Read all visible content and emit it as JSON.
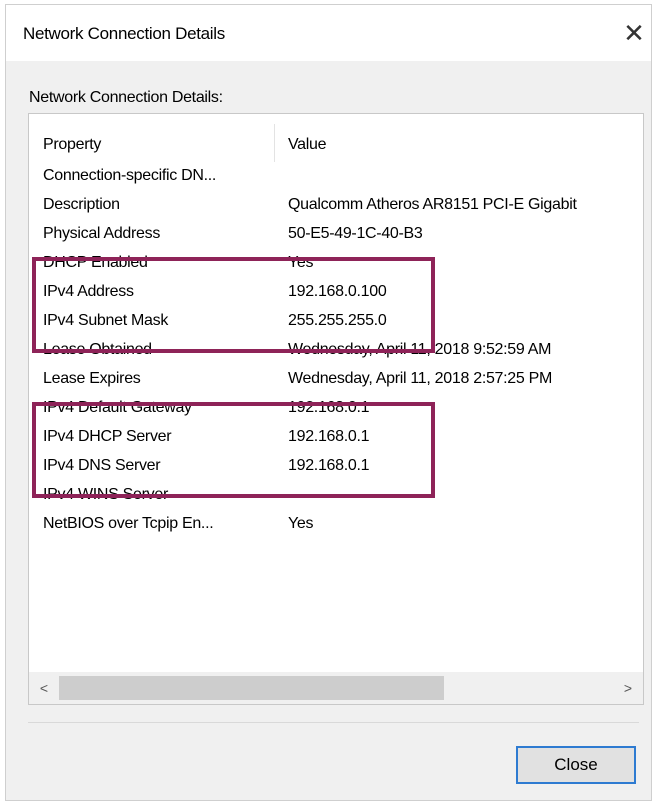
{
  "window": {
    "title": "Network Connection Details",
    "close_glyph": "✕"
  },
  "group_label": "Network Connection Details:",
  "columns": {
    "property": "Property",
    "value": "Value"
  },
  "rows": [
    {
      "property": "Connection-specific DN...",
      "value": ""
    },
    {
      "property": "Description",
      "value": "Qualcomm Atheros AR8151 PCI-E Gigabit"
    },
    {
      "property": "Physical Address",
      "value": "50-E5-49-1C-40-B3"
    },
    {
      "property": "DHCP Enabled",
      "value": "Yes"
    },
    {
      "property": "IPv4 Address",
      "value": "192.168.0.100"
    },
    {
      "property": "IPv4 Subnet Mask",
      "value": "255.255.255.0"
    },
    {
      "property": "Lease Obtained",
      "value": "Wednesday, April 11, 2018 9:52:59 AM"
    },
    {
      "property": "Lease Expires",
      "value": "Wednesday, April 11, 2018 2:57:25 PM"
    },
    {
      "property": "IPv4 Default Gateway",
      "value": "192.168.0.1"
    },
    {
      "property": "IPv4 DHCP Server",
      "value": "192.168.0.1"
    },
    {
      "property": "IPv4 DNS Server",
      "value": "192.168.0.1"
    },
    {
      "property": "IPv4 WINS Server",
      "value": ""
    },
    {
      "property": "NetBIOS over Tcpip En...",
      "value": "Yes"
    }
  ],
  "scrollbar": {
    "left_arrow": "<",
    "right_arrow": ">"
  },
  "buttons": {
    "close": "Close"
  },
  "colors": {
    "highlight": "#8e2358",
    "focus": "#2e7bd1"
  }
}
